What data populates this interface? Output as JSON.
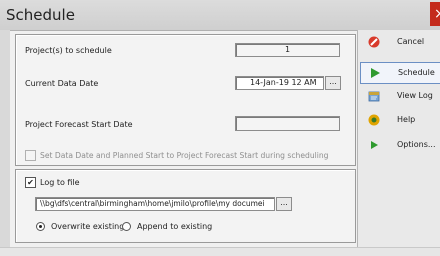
{
  "window": {
    "title": "Schedule",
    "close_glyph": "×"
  },
  "fields": {
    "projects_label": "Project(s) to schedule",
    "projects_value": "1",
    "data_date_label": "Current Data Date",
    "data_date_value": "14-Jan-19 12 AM",
    "forecast_label": "Project Forecast Start Date",
    "forecast_value": "",
    "set_date_label": "Set Data Date and Planned Start to Project Forecast Start during scheduling",
    "set_date_checked": false
  },
  "log": {
    "label": "Log to file",
    "checked": true,
    "path": "\\\\bg\\dfs\\central\\birmingham\\home\\jmilo\\profile\\my documei",
    "overwrite_label": "Overwrite existing",
    "append_label": "Append to existing",
    "selected": "overwrite"
  },
  "buttons": {
    "cancel": "Cancel",
    "schedule": "Schedule",
    "view_log": "View Log",
    "help": "Help",
    "options": "Options..."
  },
  "browse_label": "...",
  "colors": {
    "accent": "#2f9a2f",
    "cancel": "#d83a2b",
    "help": "#e0a400"
  }
}
